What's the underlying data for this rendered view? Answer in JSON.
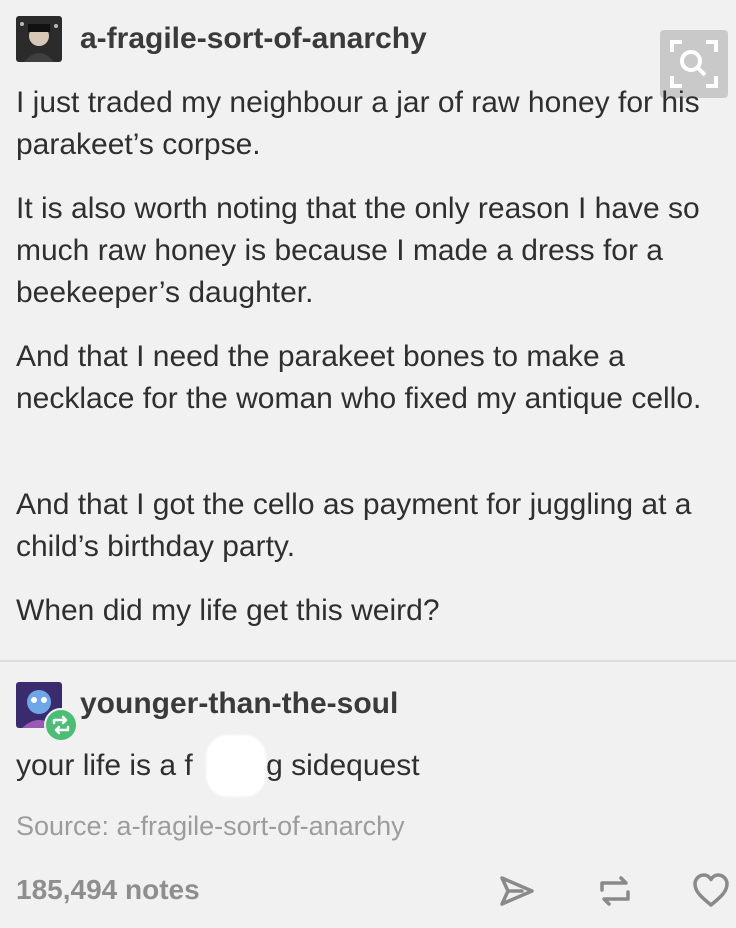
{
  "original_post": {
    "username": "a-fragile-sort-of-anarchy",
    "avatar_icon": "user-avatar-icon",
    "paragraphs": [
      "I just traded my neighbour a jar of raw honey for his parakeet’s corpse.",
      "It is also worth noting that the only reason I have so much raw honey is because I made a dress for a beekeeper’s daughter.",
      "And that I need the parakeet bones to make a necklace for the woman who fixed my antique cello.",
      "And that I got the cello as payment for juggling at a child’s birthday party.",
      "When did my life get this weird?"
    ]
  },
  "reblog": {
    "username": "younger-than-the-soul",
    "avatar_icon": "user-avatar-icon",
    "badge_icon": "reblog-icon",
    "text": "your life is a f      ing sidequest"
  },
  "source": {
    "label": "Source: a-fragile-sort-of-anarchy"
  },
  "footer": {
    "notes": "185,494 notes",
    "actions": [
      "share-icon",
      "reblog-icon",
      "heart-icon"
    ]
  },
  "zoom_icon": "zoom-icon",
  "colors": {
    "background": "#f1f1f1",
    "text": "#2f2f2f",
    "muted": "#9c9c9c",
    "reblog_green": "#4bbd74"
  }
}
